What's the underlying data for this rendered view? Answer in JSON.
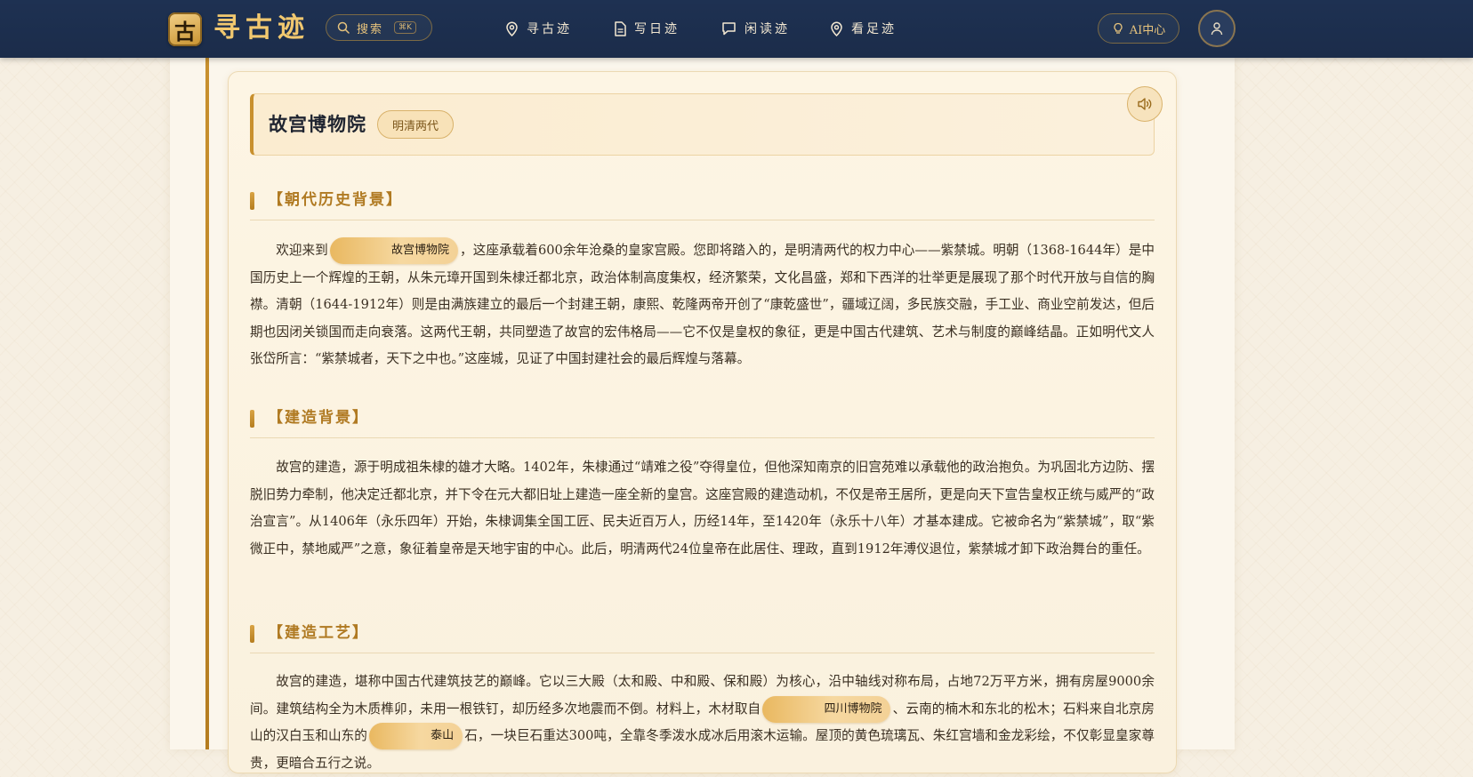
{
  "nav": {
    "logo_char": "古",
    "logo_text": "寻古迹",
    "search_label": "搜索",
    "search_shortcut": "⌘K",
    "links": [
      {
        "label": "寻古迹",
        "icon": "location-pin-icon"
      },
      {
        "label": "写日迹",
        "icon": "document-icon"
      },
      {
        "label": "闲读迹",
        "icon": "chat-bubble-icon"
      },
      {
        "label": "看足迹",
        "icon": "location-pin-icon"
      }
    ],
    "ai_label": "AI中心",
    "ai_icon": "lightbulb-icon",
    "avatar_icon": "user-icon"
  },
  "article": {
    "title": "故宫博物院",
    "era": "明清两代",
    "audio_icon": "speaker-icon",
    "sections": [
      {
        "heading": "【朝代历史背景】",
        "p_before": "欢迎来到",
        "hl": "故宫博物院",
        "p_after": "，这座承载着600余年沧桑的皇家宫殿。您即将踏入的，是明清两代的权力中心——紫禁城。明朝（1368-1644年）是中国历史上一个辉煌的王朝，从朱元璋开国到朱棣迁都北京，政治体制高度集权，经济繁荣，文化昌盛，郑和下西洋的壮举更是展现了那个时代开放与自信的胸襟。清朝（1644-1912年）则是由满族建立的最后一个封建王朝，康熙、乾隆两帝开创了“康乾盛世”，疆域辽阔，多民族交融，手工业、商业空前发达，但后期也因闭关锁国而走向衰落。这两代王朝，共同塑造了故宫的宏伟格局——它不仅是皇权的象征，更是中国古代建筑、艺术与制度的巅峰结晶。正如明代文人张岱所言：“紫禁城者，天下之中也。”这座城，见证了中国封建社会的最后辉煌与落幕。"
      },
      {
        "heading": "【建造背景】",
        "text": "故宫的建造，源于明成祖朱棣的雄才大略。1402年，朱棣通过“靖难之役”夺得皇位，但他深知南京的旧宫苑难以承载他的政治抱负。为巩固北方边防、摆脱旧势力牵制，他决定迁都北京，并下令在元大都旧址上建造一座全新的皇宫。这座宫殿的建造动机，不仅是帝王居所，更是向天下宣告皇权正统与威严的“政治宣言”。从1406年（永乐四年）开始，朱棣调集全国工匠、民夫近百万人，历经14年，至1420年（永乐十八年）才基本建成。它被命名为“紫禁城”，取“紫微正中，禁地威严”之意，象征着皇帝是天地宇宙的中心。此后，明清两代24位皇帝在此居住、理政，直到1912年溥仪退位，紫禁城才卸下政治舞台的重任。"
      },
      {
        "heading": "【建造工艺】",
        "p1": "故宫的建造，堪称中国古代建筑技艺的巅峰。它以三大殿（太和殿、中和殿、保和殿）为核心，沿中轴线对称布局，占地72万平方米，拥有房屋9000余间。建筑结构全为木质榫卯，未用一根铁钉，却历经多次地震而不倒。材料上，木材取自",
        "hl1": "四川博物院",
        "p2": "、云南的楠木和东北的松木；石料来自北京房山的汉白玉和山东的",
        "hl2": "泰山",
        "p3": "石，一块巨石重达300吨，全靠冬季泼水成冰后用滚木运输。屋顶的黄色琉璃瓦、朱红宫墙和金龙彩绘，不仅彰显皇家尊贵，更暗合五行之说。"
      }
    ]
  }
}
